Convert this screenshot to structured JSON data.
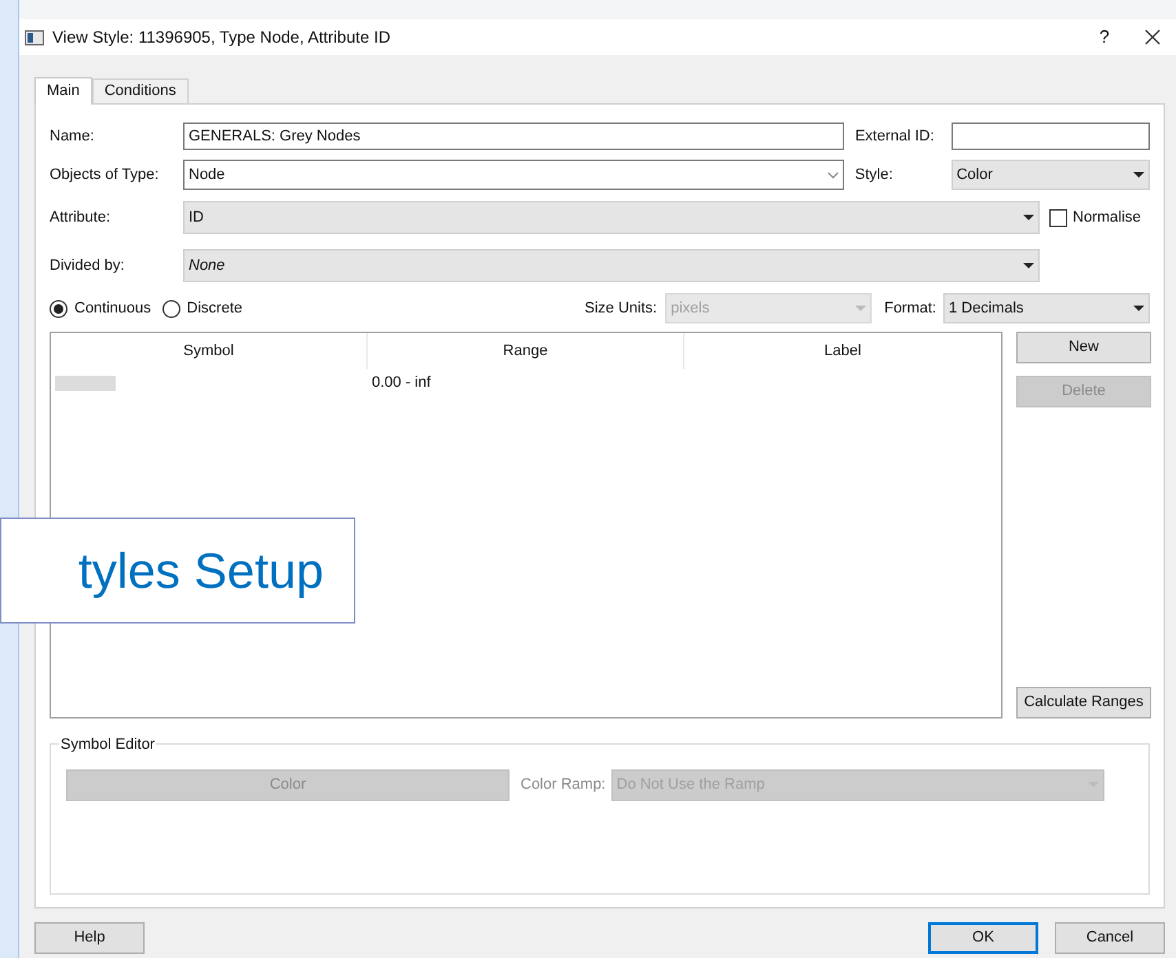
{
  "dialog": {
    "title": "View Style: 11396905, Type Node, Attribute ID",
    "help_button": "?"
  },
  "tabs": [
    {
      "label": "Main",
      "selected": true
    },
    {
      "label": "Conditions",
      "selected": false
    }
  ],
  "form": {
    "name": {
      "label": "Name:",
      "value": "GENERALS: Grey Nodes"
    },
    "external_id": {
      "label": "External ID:"
    },
    "objects_of_type": {
      "label": "Objects of Type:",
      "value": "Node"
    },
    "style": {
      "label": "Style:",
      "value": "Color"
    },
    "attribute": {
      "label": "Attribute:",
      "value": "ID"
    },
    "normalise": {
      "label": "Normalise",
      "checked": false
    },
    "divided_by": {
      "label": "Divided by:",
      "value": "None"
    },
    "mode": [
      {
        "label": "Continuous",
        "selected": true
      },
      {
        "label": "Discrete",
        "selected": false
      }
    ],
    "size_units": {
      "label": "Size Units:",
      "value": "pixels",
      "disabled": true
    },
    "format": {
      "label": "Format:",
      "value": "1 Decimals"
    }
  },
  "table": {
    "columns": [
      "Symbol",
      "Range",
      "Label"
    ],
    "rows": [
      {
        "range": "0.00 - inf"
      }
    ]
  },
  "side_buttons": [
    {
      "label": "New",
      "disabled": false
    },
    {
      "label": "Delete",
      "disabled": true
    },
    {
      "label": "Calculate Ranges",
      "disabled": false
    }
  ],
  "symbol_editor": {
    "title": "Symbol Editor",
    "color_button": {
      "label": "Color",
      "disabled": true
    },
    "color_ramp": {
      "label": "Color Ramp:",
      "value": "Do Not Use the Ramp",
      "disabled": true
    }
  },
  "footer_buttons": [
    {
      "label": "Help",
      "default": false
    },
    {
      "label": "OK",
      "default": true
    },
    {
      "label": "Cancel",
      "default": false
    }
  ],
  "callout": {
    "text": "tyles Setup"
  }
}
